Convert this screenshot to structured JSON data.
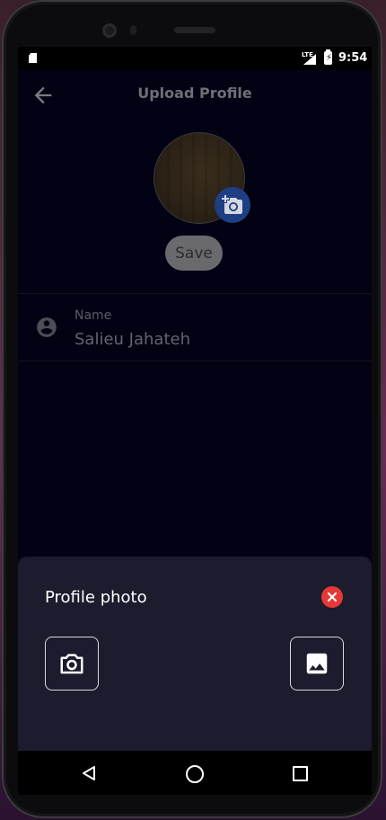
{
  "status_bar": {
    "time": "9:54",
    "network": "LTE"
  },
  "app_bar": {
    "title": "Upload Profile",
    "back_icon": "arrow-back-icon"
  },
  "profile": {
    "save_label": "Save",
    "camera_badge_icon": "add-a-photo-icon"
  },
  "name_field": {
    "label": "Name",
    "value": "Salieu Jahateh",
    "icon": "account-circle-icon"
  },
  "bottom_sheet": {
    "title": "Profile photo",
    "close_icon": "cancel-icon",
    "options": [
      {
        "icon": "camera-icon"
      },
      {
        "icon": "image-icon"
      }
    ]
  },
  "colors": {
    "screen_bg": "#020214",
    "sheet_bg": "#1c1c2e",
    "close_red": "#e53935",
    "badge_blue": "#1e3f84"
  }
}
